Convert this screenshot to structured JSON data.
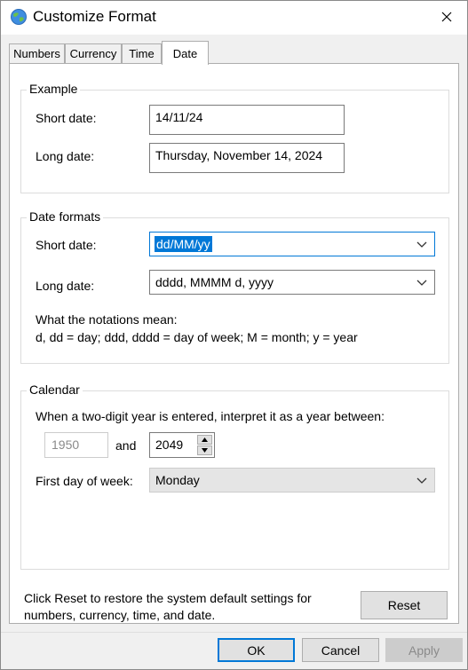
{
  "window": {
    "title": "Customize Format"
  },
  "tabs": [
    {
      "label": "Numbers"
    },
    {
      "label": "Currency"
    },
    {
      "label": "Time"
    },
    {
      "label": "Date",
      "active": true
    }
  ],
  "example": {
    "title": "Example",
    "short_label": "Short date:",
    "short_value": "14/11/24",
    "long_label": "Long date:",
    "long_value": "Thursday, November 14, 2024"
  },
  "formats": {
    "title": "Date formats",
    "short_label": "Short date:",
    "short_value": "dd/MM/yy",
    "long_label": "Long date:",
    "long_value": "dddd, MMMM d, yyyy",
    "notation_title": "What the notations mean:",
    "notation_text": "d, dd = day;  ddd, dddd = day of week;  M = month;  y = year"
  },
  "calendar": {
    "title": "Calendar",
    "two_digit_text": "When a two-digit year is entered, interpret it as a year between:",
    "year_start": "1950",
    "and_label": "and",
    "year_end": "2049",
    "first_day_label": "First day of week:",
    "first_day_value": "Monday"
  },
  "reset": {
    "text_line1": "Click Reset to restore the system default settings for",
    "text_line2": "numbers, currency, time, and date.",
    "button": "Reset"
  },
  "footer": {
    "ok": "OK",
    "cancel": "Cancel",
    "apply": "Apply"
  },
  "colors": {
    "accent": "#0078d7",
    "window_bg": "#f0f0f0",
    "panel_bg": "#ffffff"
  },
  "icons": [
    "globe-icon",
    "close-icon",
    "chevron-down-icon",
    "spin-up-icon",
    "spin-down-icon"
  ]
}
